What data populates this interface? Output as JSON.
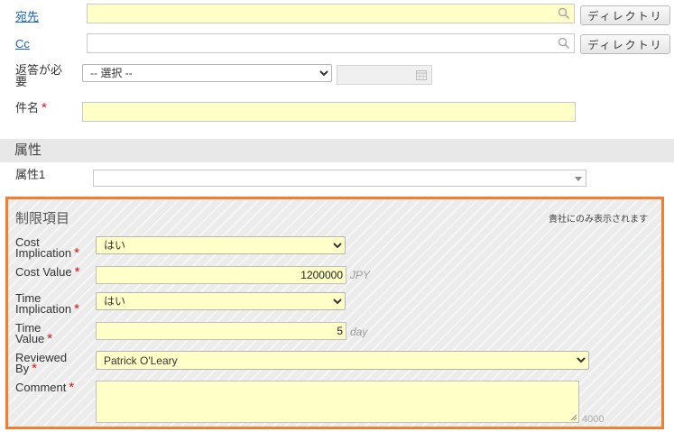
{
  "header_fields": {
    "to_label": "宛先",
    "cc_label": "Cc",
    "directory_button": "ディレクトリ",
    "response_required_label": "返答が必要",
    "response_select": "-- 選択 --",
    "subject_label": "件名",
    "required_mark": "*"
  },
  "attributes": {
    "section_title": "属性",
    "attr1_label": "属性1"
  },
  "restricted": {
    "title": "制限項目",
    "note": "貴社にのみ表示されます",
    "cost_implication_label": "Cost Implication",
    "cost_implication_value": "はい",
    "cost_value_label": "Cost Value",
    "cost_value": "1200000",
    "cost_unit": "JPY",
    "time_implication_label": "Time Implication",
    "time_implication_value": "はい",
    "time_value_label": "Time Value",
    "time_value": "5",
    "time_unit": "day",
    "reviewed_by_label": "Reviewed By",
    "reviewed_by_value": "Patrick O'Leary",
    "comment_label": "Comment",
    "comment_counter": "4000"
  },
  "colors": {
    "accent_border": "#ef7f33",
    "required": "#dd1111",
    "field_yellow": "#ffffc8",
    "link": "#1a66c2"
  },
  "icons": [
    "search-icon",
    "calendar-icon",
    "dropdown-arrow-icon",
    "resize-handle-icon"
  ]
}
